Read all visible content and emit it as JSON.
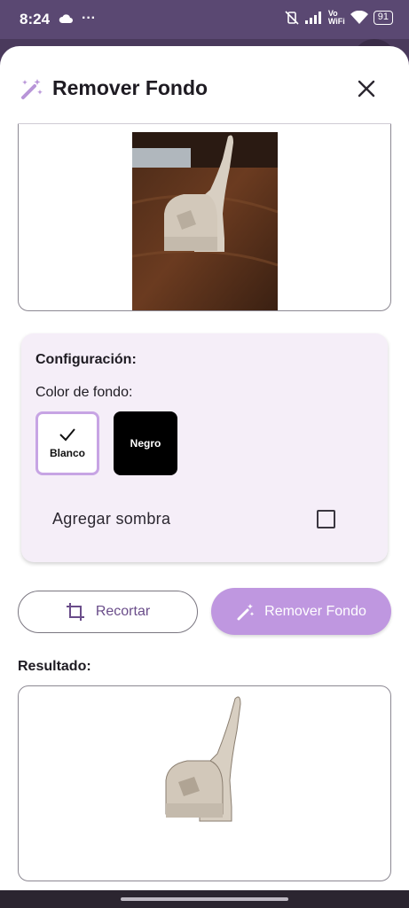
{
  "status_bar": {
    "time": "8:24",
    "more": "···",
    "vowifi": "Vo\nWiFi",
    "battery": "91"
  },
  "header": {
    "title": "Remover Fondo",
    "icon": "magic-wand-icon",
    "close_icon": "close-icon"
  },
  "config": {
    "title": "Configuración:",
    "color_label": "Color de fondo:",
    "colors": [
      {
        "label": "Blanco",
        "color": "#ffffff",
        "selected": true
      },
      {
        "label": "Negro",
        "color": "#000000",
        "selected": false
      }
    ],
    "shadow_label": "Agregar sombra",
    "shadow_checked": false
  },
  "actions": {
    "crop_label": "Recortar",
    "crop_icon": "crop-icon",
    "remove_label": "Remover Fondo",
    "remove_icon": "magic-wand-icon"
  },
  "result": {
    "title": "Resultado:"
  },
  "colors": {
    "accent": "#bf97e0",
    "status_bar": "#5a4872",
    "card_bg": "#f5eef8"
  }
}
